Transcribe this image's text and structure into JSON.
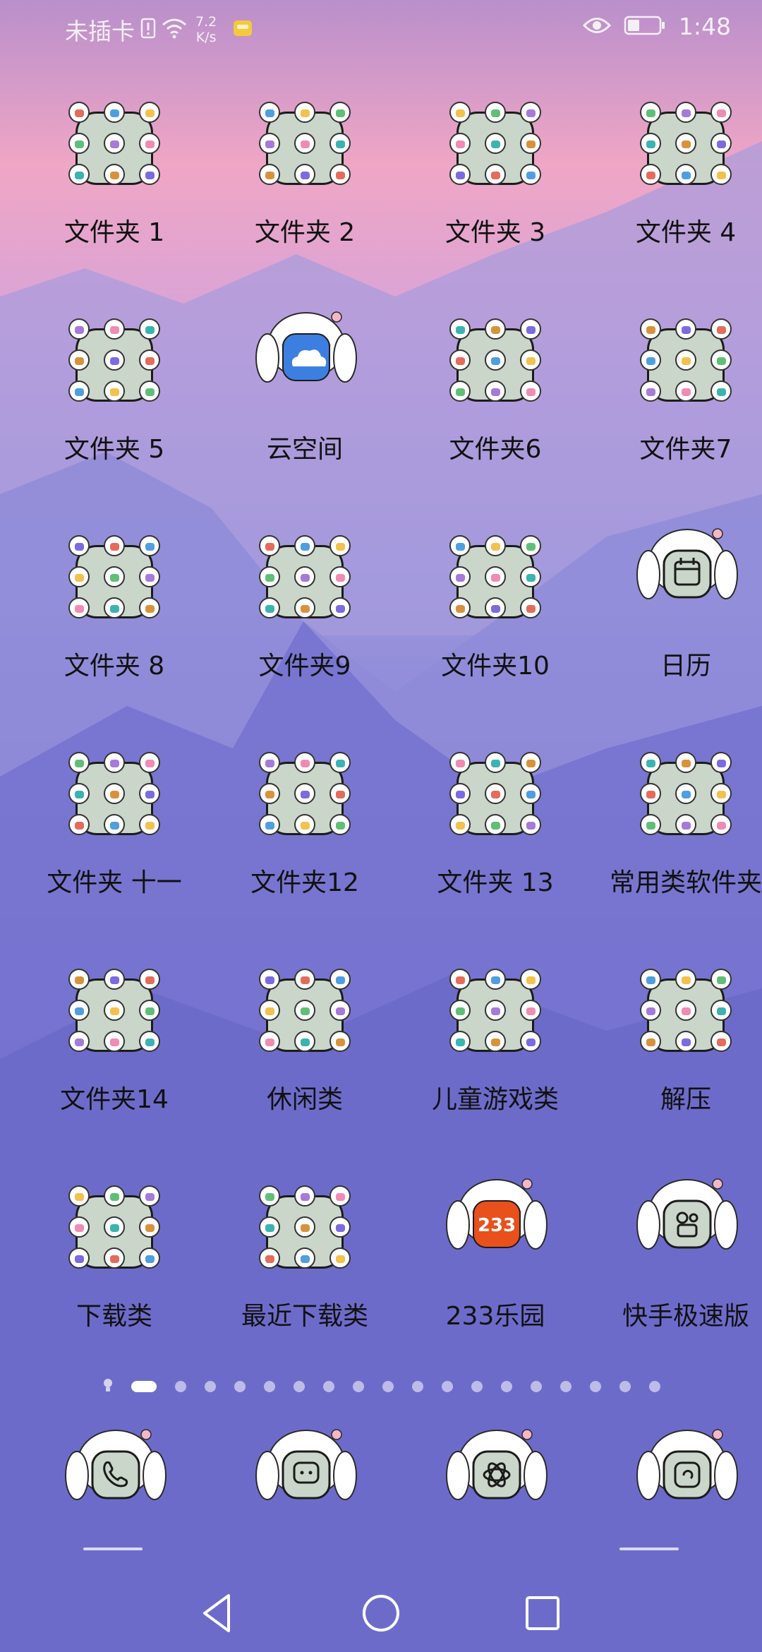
{
  "status_bar": {
    "carrier": "未插卡",
    "speed_value": "7.2",
    "speed_unit": "K/s",
    "time": "1:48"
  },
  "icons": [
    {
      "label": "文件夹 1",
      "kind": "folder"
    },
    {
      "label": "文件夹 2",
      "kind": "folder"
    },
    {
      "label": "文件夹 3",
      "kind": "folder"
    },
    {
      "label": "文件夹 4",
      "kind": "folder"
    },
    {
      "label": "文件夹 5",
      "kind": "folder"
    },
    {
      "label": "云空间",
      "kind": "app",
      "icon": "cloud-icon"
    },
    {
      "label": "文件夹6",
      "kind": "folder"
    },
    {
      "label": "文件夹7",
      "kind": "folder"
    },
    {
      "label": "文件夹 8",
      "kind": "folder"
    },
    {
      "label": "文件夹9",
      "kind": "folder"
    },
    {
      "label": "文件夹10",
      "kind": "folder"
    },
    {
      "label": "日历",
      "kind": "app",
      "icon": "calendar-icon"
    },
    {
      "label": "文件夹 十一",
      "kind": "folder"
    },
    {
      "label": "文件夹12",
      "kind": "folder"
    },
    {
      "label": "文件夹 13",
      "kind": "folder"
    },
    {
      "label": "常用类软件夹",
      "kind": "folder"
    },
    {
      "label": "文件夹14",
      "kind": "folder"
    },
    {
      "label": "休闲类",
      "kind": "folder"
    },
    {
      "label": "儿童游戏类",
      "kind": "folder"
    },
    {
      "label": "解压",
      "kind": "folder"
    },
    {
      "label": "下载类",
      "kind": "folder"
    },
    {
      "label": "最近下载类",
      "kind": "folder"
    },
    {
      "label": "233乐园",
      "kind": "app",
      "icon": "233-icon",
      "badge": "233"
    },
    {
      "label": "快手极速版",
      "kind": "app",
      "icon": "kuaishou-icon"
    }
  ],
  "page_indicator": {
    "count": 18,
    "active": 1
  },
  "dock": [
    {
      "name": "phone",
      "icon": "phone-icon"
    },
    {
      "name": "messages",
      "icon": "message-icon"
    },
    {
      "name": "browser",
      "icon": "browser-icon"
    },
    {
      "name": "camera",
      "icon": "camera-icon"
    }
  ],
  "colors": {
    "sky_top": "#c98fc4",
    "sky_pink": "#f2a9c7",
    "mountain": "#7a74cf",
    "folder_fill": "#c9d6c9",
    "accent_233": "#e8501c",
    "cloud_blue": "#3d7fe0"
  }
}
